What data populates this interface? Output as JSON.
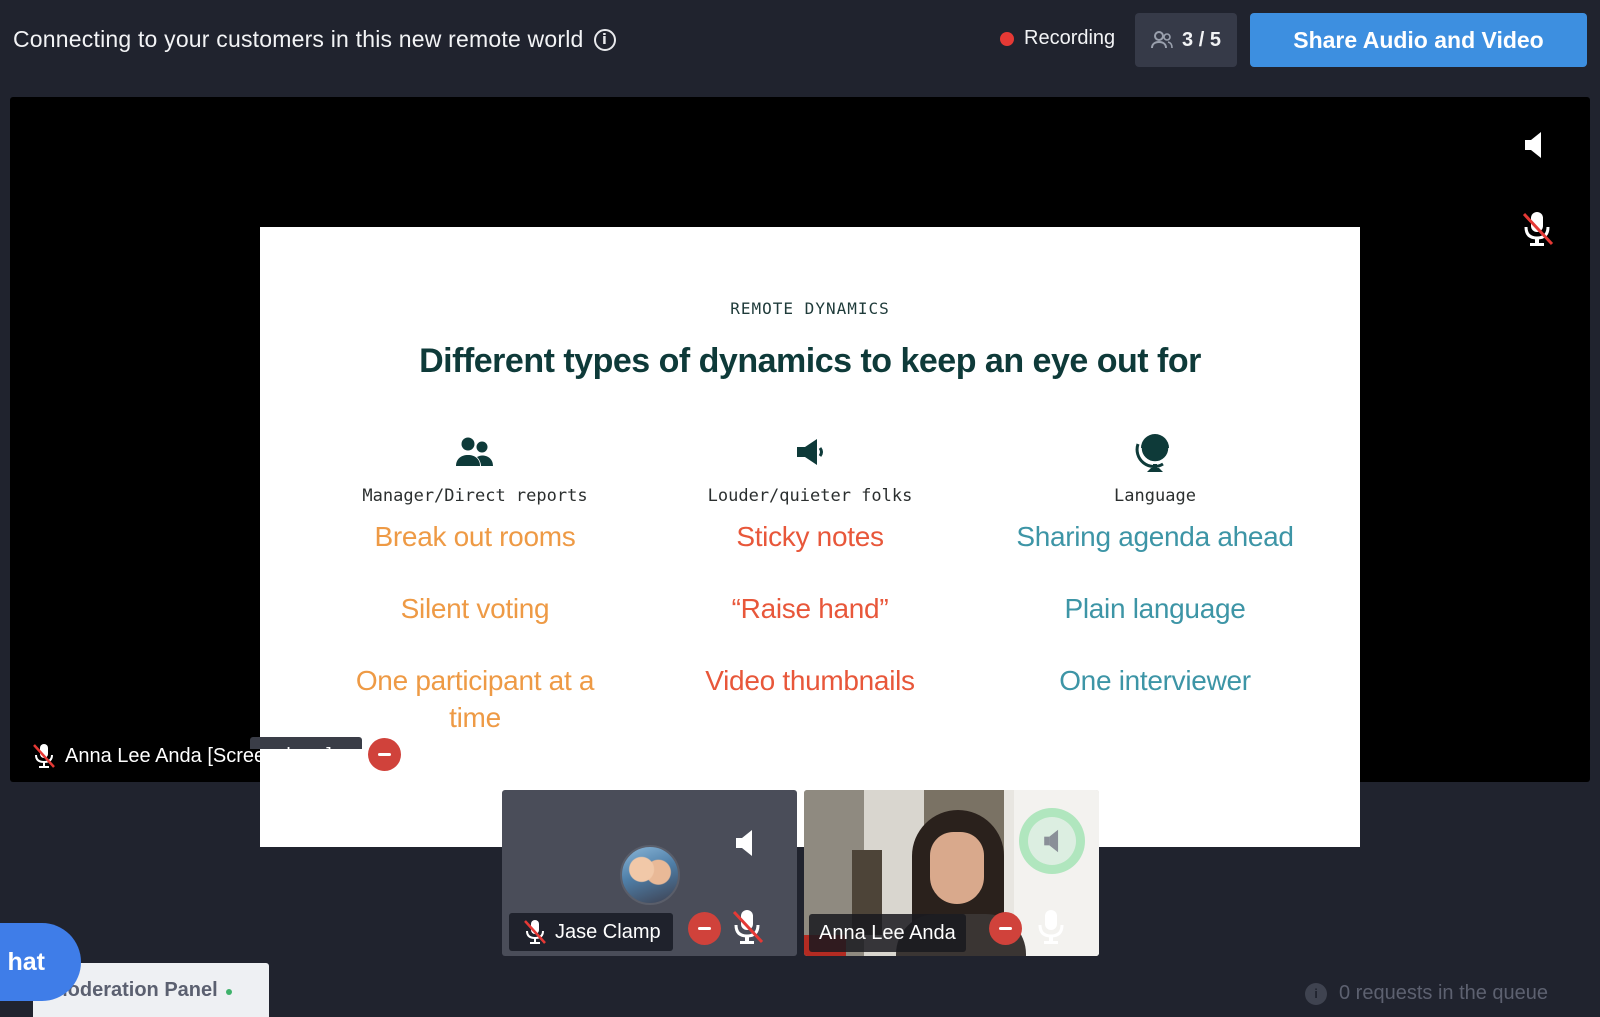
{
  "header": {
    "session_title": "Connecting to your customers in this new remote world",
    "recording_label": "Recording",
    "participants_count": "3 / 5",
    "share_button_label": "Share Audio and Video"
  },
  "slide": {
    "kicker": "REMOTE DYNAMICS",
    "title": "Different types of dynamics to keep an eye out for",
    "columns": [
      {
        "icon": "people-icon",
        "label": "Manager/Direct reports",
        "items": [
          "Break out rooms",
          "Silent voting",
          "One participant at a time"
        ]
      },
      {
        "icon": "megaphone-icon",
        "label": "Louder/quieter folks",
        "items": [
          "Sticky notes",
          "“Raise hand”",
          "Video thumbnails"
        ]
      },
      {
        "icon": "globe-icon",
        "label": "Language",
        "items": [
          "Sharing agenda ahead",
          "Plain language",
          "One interviewer"
        ]
      }
    ]
  },
  "stage": {
    "presenter_name": "Anna Lee Anda [Screenshare]"
  },
  "thumbnails": [
    {
      "name": "Jase Clamp"
    },
    {
      "name": "Anna Lee Anda"
    }
  ],
  "footer": {
    "chat_label": "hat",
    "moderation_label": "Moderation Panel",
    "queue_text": "0 requests in the queue"
  },
  "colors": {
    "background": "#20232e",
    "accent_blue": "#3d8fe0",
    "recording_red": "#e53935",
    "slide_orange": "#ee9a45",
    "slide_red": "#e8573a",
    "slide_teal": "#3d95a6"
  }
}
